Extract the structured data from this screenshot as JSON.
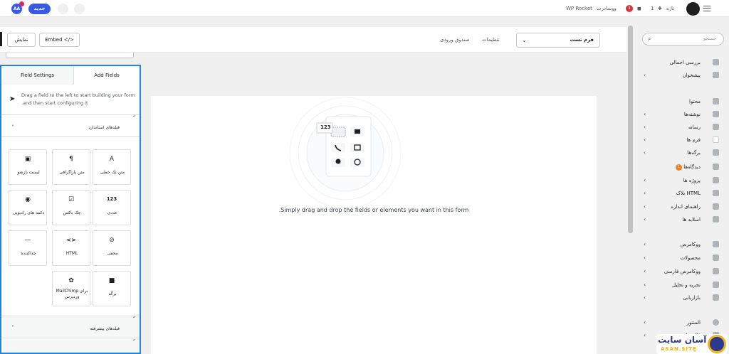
{
  "topbar": {
    "avatar": "AA",
    "new_button": "جدید",
    "site_name": "ووسادرت",
    "wp_rocket": "WP Rocket",
    "notification_count": "1",
    "new_label": "تازه",
    "comment_count": "1"
  },
  "toolbar": {
    "preview_label": "نمایش",
    "embed_label": "Embed </>",
    "inbox_link": "صندوق ورودی",
    "settings_link": "تنظیمات",
    "form_select_value": "فرم تست"
  },
  "panel": {
    "tab_add_fields": "Add Fields",
    "tab_field_settings": "Field Settings",
    "hint_line1": "Drag a field to the left to start building your form",
    "hint_line2": ".and then start configuring it",
    "section_standard": "فیلدهای استاندارد",
    "section_advanced": "فیلدهای پیشرفته",
    "fields": [
      {
        "label": "متن تک خطی",
        "icon": "A"
      },
      {
        "label": "متن پاراگرافی",
        "icon": "¶"
      },
      {
        "label": "لیست بازشو",
        "icon": "▣"
      },
      {
        "label": "عددی",
        "icon": "123"
      },
      {
        "label": "چک باکس",
        "icon": "☑"
      },
      {
        "label": "دکمه های رادیویی",
        "icon": "◉"
      },
      {
        "label": "مخفی",
        "icon": "⊘"
      },
      {
        "label": "HTML",
        "icon": "<>"
      },
      {
        "label": "جداکننده",
        "icon": "—"
      },
      {
        "label": "برگه",
        "icon": "■"
      },
      {
        "label": "MailChimp برای وردپرس",
        "icon": "✿"
      }
    ]
  },
  "canvas": {
    "message": ".Simply drag and drop the fields or elements you want in this form",
    "illustration_badge": "123"
  },
  "sidebar": {
    "search_placeholder": "جستجو",
    "items": [
      {
        "label": "بررسی اجمالی"
      },
      {
        "label": "پیشخوان"
      },
      {
        "label": "محتوا"
      },
      {
        "label": "نوشته‌ها"
      },
      {
        "label": "رسانه"
      },
      {
        "label": "فرم ها"
      },
      {
        "label": "برگه‌ها"
      },
      {
        "label": "دیدگاه‌ها",
        "badge": "1"
      },
      {
        "label": "پروژه ها"
      },
      {
        "label": "بلاک HTML"
      },
      {
        "label": "راهنمای اندازه"
      },
      {
        "label": "اسلاید ها"
      },
      {
        "label": "ووکامرس"
      },
      {
        "label": "محصولات"
      },
      {
        "label": "ووکامرس فارسی"
      },
      {
        "label": "تجربه و تحلیل"
      },
      {
        "label": "بازاریابی"
      },
      {
        "label": "المنتور"
      },
      {
        "label": "قالب‌ها"
      }
    ]
  },
  "logo": {
    "text_fa": "آسان سایت",
    "text_en": "ASAN.SITE"
  }
}
